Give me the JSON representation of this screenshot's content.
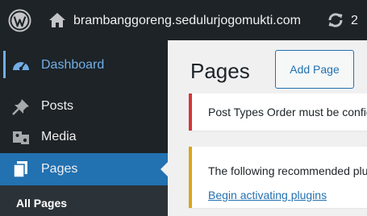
{
  "adminbar": {
    "logo_icon": "wordpress-icon",
    "home_icon": "home-icon",
    "site_name": "brambanggoreng.sedulurjogomukti.com",
    "updates_icon": "refresh-icon",
    "updates_count": "2"
  },
  "sidebar": {
    "items": [
      {
        "label": "Dashboard",
        "icon": "dashboard-icon"
      },
      {
        "label": "Posts",
        "icon": "pin-icon"
      },
      {
        "label": "Media",
        "icon": "media-icon"
      },
      {
        "label": "Pages",
        "icon": "pages-icon"
      }
    ],
    "submenu": {
      "all_pages": "All Pages"
    }
  },
  "main": {
    "title": "Pages",
    "add_button": "Add Page",
    "notices": [
      {
        "type": "error",
        "text": "Post Types Order must be configured"
      },
      {
        "type": "warning",
        "text": "The following recommended plugins",
        "link": "Begin activating plugins"
      }
    ]
  },
  "colors": {
    "adminbar_bg": "#1d2327",
    "accent": "#2271b1",
    "dashboard_highlight": "#72aee6",
    "error": "#d63638",
    "warning": "#dba617",
    "content_bg": "#f0f0f1"
  }
}
